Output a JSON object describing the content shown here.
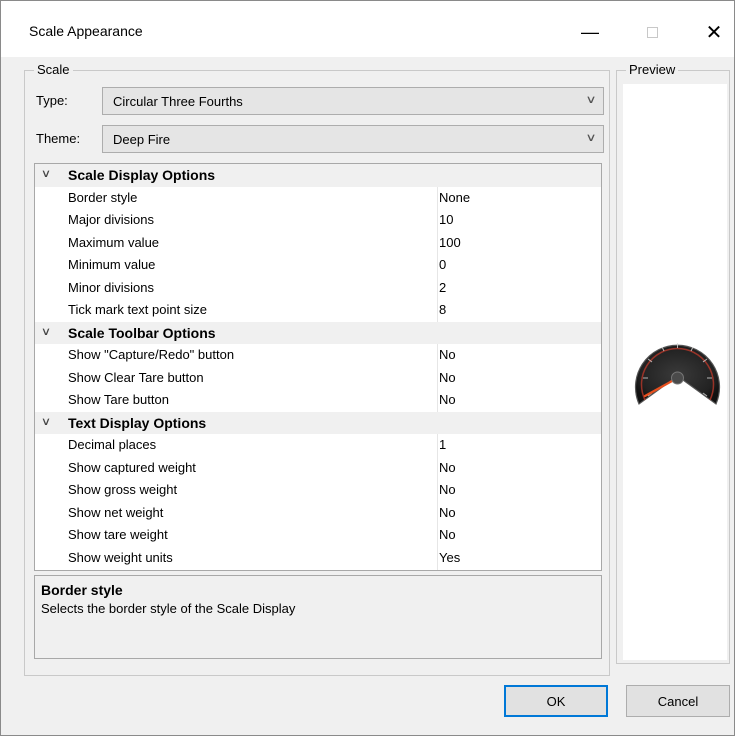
{
  "window": {
    "title": "Scale Appearance"
  },
  "titlebar": {
    "minimize_glyph": "—",
    "close_glyph": "✕"
  },
  "groups": {
    "scale_label": "Scale",
    "preview_label": "Preview"
  },
  "fields": {
    "type_label": "Type:",
    "type_value": "Circular Three Fourths",
    "theme_label": "Theme:",
    "theme_value": "Deep Fire"
  },
  "categories": [
    {
      "name": "Scale Display Options"
    },
    {
      "name": "Scale Toolbar Options"
    },
    {
      "name": "Text Display Options"
    }
  ],
  "properties": [
    {
      "name": "Border style",
      "value": "None"
    },
    {
      "name": "Major divisions",
      "value": "10"
    },
    {
      "name": "Maximum value",
      "value": "100"
    },
    {
      "name": "Minimum value",
      "value": "0"
    },
    {
      "name": "Minor divisions",
      "value": "2"
    },
    {
      "name": "Tick mark text point size",
      "value": "8"
    },
    {
      "name": "Show \"Capture/Redo\" button",
      "value": "No"
    },
    {
      "name": "Show Clear Tare button",
      "value": "No"
    },
    {
      "name": "Show Tare button",
      "value": "No"
    },
    {
      "name": "Decimal places",
      "value": "1"
    },
    {
      "name": "Show captured weight",
      "value": "No"
    },
    {
      "name": "Show gross weight",
      "value": "No"
    },
    {
      "name": "Show net weight",
      "value": "No"
    },
    {
      "name": "Show tare weight",
      "value": "No"
    },
    {
      "name": "Show weight units",
      "value": "Yes"
    }
  ],
  "description": {
    "title": "Border style",
    "text": "Selects the border style of the Scale Display"
  },
  "buttons": {
    "ok": "OK",
    "cancel": "Cancel"
  },
  "colors": {
    "accent": "#0078d7",
    "gauge_face": "#2b2b2b",
    "gauge_needle": "#e8501e"
  }
}
